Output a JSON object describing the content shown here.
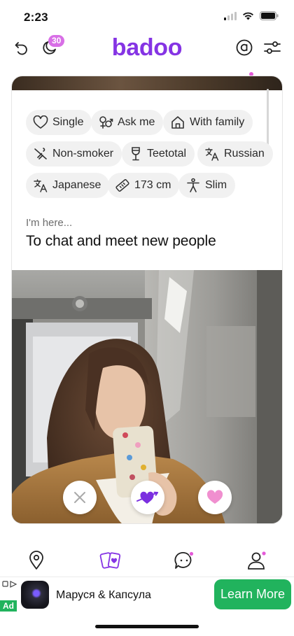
{
  "status_bar": {
    "time": "2:23"
  },
  "header": {
    "logo_text": "badoo",
    "notification_count": "30",
    "icons": [
      "undo-icon",
      "moon-icon",
      "coin-icon",
      "filters-icon"
    ],
    "accent": "#8534e4"
  },
  "profile": {
    "chips": [
      {
        "label": "Single",
        "icon": "heart-outline-icon"
      },
      {
        "label": "Ask me",
        "icon": "gender-icon"
      },
      {
        "label": "With family",
        "icon": "home-icon"
      },
      {
        "label": "Non-smoker",
        "icon": "no-smoking-icon"
      },
      {
        "label": "Teetotal",
        "icon": "wine-glass-icon"
      },
      {
        "label": "Russian",
        "icon": "translate-icon"
      },
      {
        "label": "Japanese",
        "icon": "translate-icon"
      },
      {
        "label": "173 cm",
        "icon": "ruler-icon"
      },
      {
        "label": "Slim",
        "icon": "body-icon"
      }
    ],
    "im_here_label": "I'm here...",
    "purpose": "To chat and meet new people"
  },
  "actions": [
    "pass",
    "crush",
    "like"
  ],
  "bottom_nav": [
    "location-icon",
    "cards-icon",
    "chat-icon",
    "profile-icon"
  ],
  "ad": {
    "tag": "Ad",
    "title": "Маруся & Капсула",
    "cta": "Learn More",
    "cta_color": "#21b35d"
  }
}
